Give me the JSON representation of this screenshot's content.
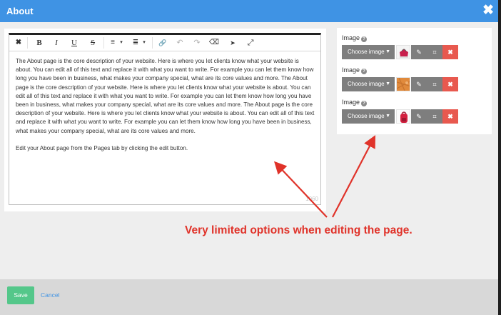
{
  "header": {
    "title": "About",
    "close_glyph": "✖"
  },
  "toolbar": {
    "clear_format": "✖",
    "bold": "B",
    "italic": "I",
    "underline": "U",
    "strike": "S",
    "ordered_list": "≡",
    "unordered_list": "≣",
    "caret": "▾",
    "link": "🔗",
    "undo": "↶",
    "redo": "↷",
    "eraser": "⌫",
    "pointer": "➤",
    "expand": "⤢"
  },
  "editor": {
    "paragraphs": [
      "The About page is the core description of your website. Here is where you let clients know what your website is about. You can edit all of this text and replace it with what you want to write. For example you can let them know how long you have been in business, what makes your company special, what are its core values and more. The About page is the core description of your website. Here is where you let clients know what your website is about. You can edit all of this text and replace it with what you want to write. For example you can let them know how long you have been in business, what makes your company special, what are its core values and more. The About page is the core description of your website. Here is where you let clients know what your website is about. You can edit all of this text and replace it with what you want to write. For example you can let them know how long you have been in business, what makes your company special, what are its core values and more.",
      "Edit your About page from the Pages tab by clicking the edit button."
    ],
    "char_count": "1060"
  },
  "images": [
    {
      "label": "Image",
      "help": "?",
      "choose_label": "Choose image",
      "edit_glyph": "✎",
      "crop_glyph": "⌗",
      "delete_glyph": "✖",
      "thumb_colors": [
        "#c81e4b",
        "#f2f2f2"
      ]
    },
    {
      "label": "Image",
      "help": "?",
      "choose_label": "Choose image",
      "edit_glyph": "✎",
      "crop_glyph": "⌗",
      "delete_glyph": "✖",
      "thumb_colors": [
        "#e08a3c",
        "#c8732d"
      ]
    },
    {
      "label": "Image",
      "help": "?",
      "choose_label": "Choose image",
      "edit_glyph": "✎",
      "crop_glyph": "⌗",
      "delete_glyph": "✖",
      "thumb_colors": [
        "#d3203f",
        "#9e1831"
      ]
    }
  ],
  "annotation": {
    "text": "Very limited options when editing the page.",
    "color": "#e0332a"
  },
  "footer": {
    "save_label": "Save",
    "cancel_label": "Cancel"
  },
  "colors": {
    "header": "#3f93e4",
    "save": "#54c78a",
    "delete": "#e8594f",
    "control": "#7e7e7e"
  }
}
